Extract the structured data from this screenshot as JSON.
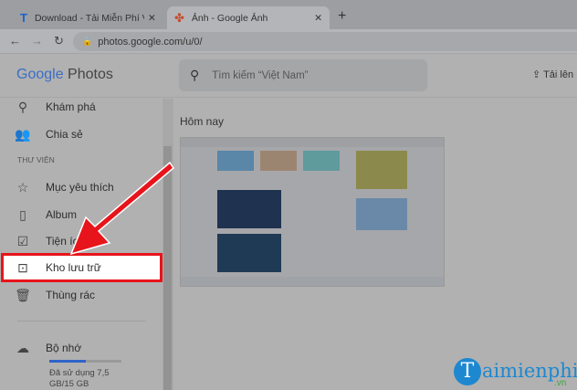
{
  "browser": {
    "tabs": [
      {
        "label": "Download - Tải Miễn Phí VN - Ph",
        "icon": "taimienphi-t-icon"
      },
      {
        "label": "Ảnh - Google Ảnh",
        "icon": "google-photos-pinwheel-icon"
      }
    ],
    "url": "photos.google.com/u/0/"
  },
  "app": {
    "logo_google": "Google",
    "logo_photos": "Photos",
    "search_placeholder": "Tìm kiếm “Việt Nam”",
    "upload_label": "Tải lên"
  },
  "sidebar": {
    "items": [
      {
        "label": "Khám phá",
        "icon": "search-icon"
      },
      {
        "label": "Chia sẻ",
        "icon": "people-icon"
      }
    ],
    "section": "THƯ VIỆN",
    "library": [
      {
        "label": "Mục yêu thích",
        "icon": "star-icon"
      },
      {
        "label": "Album",
        "icon": "album-icon"
      },
      {
        "label": "Tiện ích",
        "icon": "utilities-icon"
      },
      {
        "label": "Kho lưu trữ",
        "icon": "archive-icon"
      },
      {
        "label": "Thùng rác",
        "icon": "trash-icon"
      }
    ],
    "storage": {
      "label": "Bộ nhớ",
      "used_fraction": 0.5,
      "text1": "Đã sử dụng 7,5",
      "text2": "GB/15 GB"
    }
  },
  "main": {
    "section_title": "Hôm nay"
  },
  "watermark": {
    "text": "Taimienphi",
    ".vn": ".vn"
  },
  "colors": {
    "highlight": "#e8141b",
    "storage_bar": "#2f63c9"
  }
}
